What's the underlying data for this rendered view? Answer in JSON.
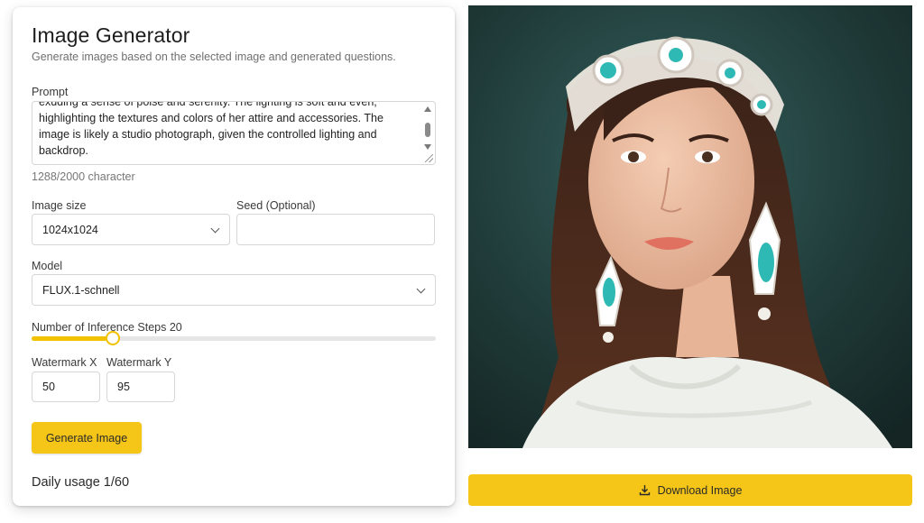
{
  "app": {
    "title": "Image Generator",
    "subtitle": "Generate images based on the selected image and generated questions."
  },
  "prompt": {
    "label": "Prompt",
    "lines": [
      "exuding a sense of poise and serenity. The lighting is soft and even,",
      "highlighting the textures and colors of her attire and accessories. The",
      "image is likely a studio photograph, given the controlled lighting and",
      "backdrop."
    ],
    "char_count": "1288/2000 character"
  },
  "image_size": {
    "label": "Image size",
    "value": "1024x1024"
  },
  "seed": {
    "label": "Seed (Optional)",
    "value": ""
  },
  "model": {
    "label": "Model",
    "value": "FLUX.1-schnell"
  },
  "inference_steps": {
    "label": "Number of Inference Steps 20",
    "fraction": 0.2
  },
  "watermark": {
    "x_label": "Watermark X",
    "x_value": "50",
    "y_label": "Watermark Y",
    "y_value": "95"
  },
  "generate_button": "Generate Image",
  "daily_usage": "Daily usage 1/60",
  "download_button": "Download Image",
  "colors": {
    "accent": "#f5c518",
    "slider": "#f2c200",
    "backdrop": "#1f3534"
  },
  "icons": {
    "download": "download-icon",
    "dropdown": "chevron-down-icon"
  }
}
